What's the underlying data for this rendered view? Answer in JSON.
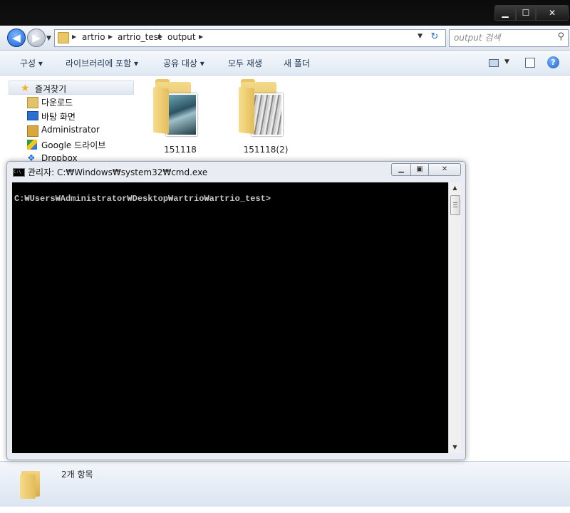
{
  "explorer": {
    "breadcrumb": [
      "artrio",
      "artrio_test",
      "output"
    ],
    "search_placeholder": "output 검색",
    "commands": [
      "구성 ▾",
      "라이브러리에 포함 ▾",
      "공유 대상 ▾",
      "모두 재생",
      "새 폴더"
    ],
    "nav": {
      "favorites_label": "즐겨찾기",
      "items": [
        "다운로드",
        "바탕 화면",
        "Administrator",
        "Google 드라이브",
        "Dropbox"
      ]
    },
    "folders": [
      {
        "name": "151118",
        "thumb": "teal"
      },
      {
        "name": "151118(2)",
        "thumb": "gray"
      }
    ],
    "status_count": "2개 항목"
  },
  "cmd": {
    "title": "관리자: C:₩Windows₩system32₩cmd.exe",
    "prompt": "C:₩Users₩Administrator₩Desktop₩artrio₩artrio_test>"
  },
  "colors": {
    "titlebar": "#0b0b0b",
    "console_bg": "#000000",
    "console_fg": "#c6c6c6",
    "folder": "#e9c766"
  }
}
